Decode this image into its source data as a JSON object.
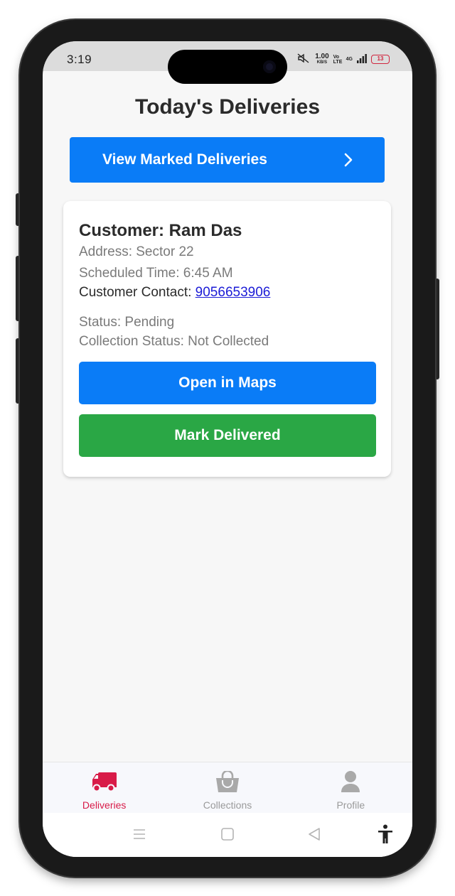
{
  "status_bar": {
    "time": "3:19",
    "speed_value": "1.00",
    "speed_unit": "KB/S",
    "network": "Vo LTE",
    "signal": "4G",
    "battery": "13"
  },
  "page": {
    "title": "Today's Deliveries",
    "view_marked_label": "View Marked Deliveries"
  },
  "delivery": {
    "customer_label": "Customer: Ram Das",
    "address": "Address: Sector 22",
    "scheduled_time": "Scheduled Time: 6:45 AM",
    "contact_prefix": "Customer Contact: ",
    "contact_number": "9056653906",
    "status": "Status: Pending",
    "collection_status": "Collection Status: Not Collected",
    "open_maps_label": "Open in Maps",
    "mark_delivered_label": "Mark Delivered"
  },
  "tabs": [
    {
      "label": "Deliveries",
      "icon": "truck-icon",
      "active": true
    },
    {
      "label": "Collections",
      "icon": "shopping-bag-icon",
      "active": false
    },
    {
      "label": "Profile",
      "icon": "person-icon",
      "active": false
    }
  ],
  "colors": {
    "primary": "#0a7cf7",
    "success": "#2aa745",
    "active_tab": "#d81b48",
    "inactive_tab": "#9a9a9a"
  }
}
